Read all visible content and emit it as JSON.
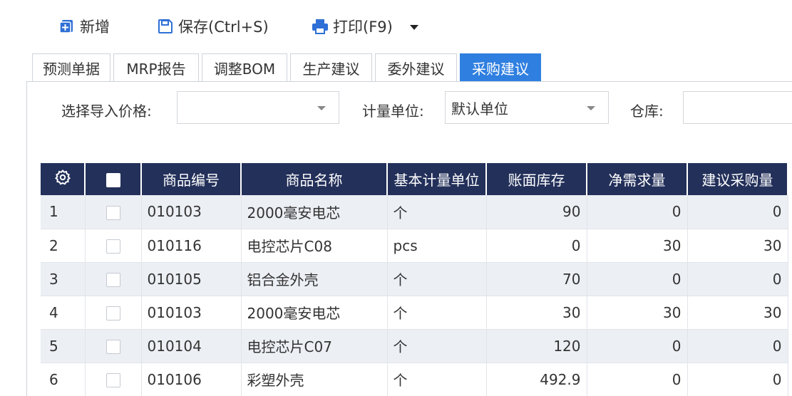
{
  "toolbar": {
    "add_label": "新增",
    "save_label": "保存(Ctrl+S)",
    "print_label": "打印(F9)",
    "add_icon": "add-document-icon",
    "save_icon": "floppy-disk-icon",
    "print_icon": "printer-icon",
    "more_icon": "caret-down-icon",
    "icon_color": "#2f6fd6"
  },
  "tabs": [
    {
      "label": "预测单据",
      "active": false
    },
    {
      "label": "MRP报告",
      "active": false
    },
    {
      "label": "调整BOM",
      "active": false
    },
    {
      "label": "生产建议",
      "active": false
    },
    {
      "label": "委外建议",
      "active": false
    },
    {
      "label": "采购建议",
      "active": true
    }
  ],
  "filters": {
    "price_label": "选择导入价格:",
    "price_value": "",
    "unit_label": "计量单位:",
    "unit_value": "默认单位",
    "warehouse_label": "仓库:",
    "warehouse_value": ""
  },
  "table": {
    "settings_icon": "gear-icon",
    "columns": [
      "商品编号",
      "商品名称",
      "基本计量单位",
      "账面库存",
      "净需求量",
      "建议采购量"
    ],
    "rows": [
      {
        "idx": "1",
        "code": "010103",
        "name": "2000毫安电芯",
        "unit": "个",
        "stock": "90",
        "net": "0",
        "suggest": "0"
      },
      {
        "idx": "2",
        "code": "010116",
        "name": "电控芯片C08",
        "unit": "pcs",
        "stock": "0",
        "net": "30",
        "suggest": "30"
      },
      {
        "idx": "3",
        "code": "010105",
        "name": "铝合金外壳",
        "unit": "个",
        "stock": "70",
        "net": "0",
        "suggest": "0"
      },
      {
        "idx": "4",
        "code": "010103",
        "name": "2000毫安电芯",
        "unit": "个",
        "stock": "30",
        "net": "30",
        "suggest": "30"
      },
      {
        "idx": "5",
        "code": "010104",
        "name": "电控芯片C07",
        "unit": "个",
        "stock": "120",
        "net": "0",
        "suggest": "0"
      },
      {
        "idx": "6",
        "code": "010106",
        "name": "彩塑外壳",
        "unit": "个",
        "stock": "492.9",
        "net": "0",
        "suggest": "0"
      }
    ],
    "header_color": "#23305a",
    "stripe_color": "#eceff4"
  },
  "colors": {
    "accent": "#2f7fe0"
  }
}
